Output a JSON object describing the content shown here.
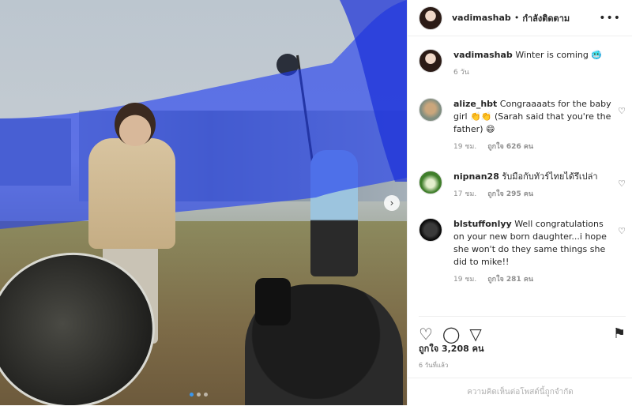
{
  "post": {
    "author": "vadimashab",
    "follow_label": "กำลังติดตาม",
    "header_separator": "•",
    "more_label": "•••",
    "next_label": "›",
    "carousel_dots": 3,
    "carousel_active_index": 0
  },
  "caption": {
    "username": "vadimashab",
    "text": "Winter is coming 🥶",
    "time": "6 วัน"
  },
  "comments": [
    {
      "username": "alize_hbt",
      "text": "Congraaaats for the baby girl 👏👏 (Sarah said that you're the father) 😄",
      "time": "19 ชม.",
      "likes": "ถูกใจ 626 คน"
    },
    {
      "username": "nipnan28",
      "text": "รับมือกับทัวร์ไทยได้รึเปล่า",
      "time": "17 ชม.",
      "likes": "ถูกใจ 295 คน"
    },
    {
      "username": "blstuffonlyy",
      "text": "Well congratulations on your new born daughter...i hope she won't do they same things she did to mike!!",
      "time": "19 ชม.",
      "likes": "ถูกใจ 281 คน"
    }
  ],
  "icons": {
    "like": "♡",
    "comment": "◯",
    "share": "▽",
    "save": "⚑",
    "comment_like": "♡"
  },
  "likes_total": "ถูกใจ 3,208 คน",
  "timestamp": "6 วันที่แล้ว",
  "comments_restricted": "ความคิดเห็นต่อโพสต์นี้ถูกจำกัด",
  "colors": {
    "fabric_blue": "#1e3cf0",
    "link_blue": "#3897f0",
    "muted": "#8e8e8e"
  }
}
